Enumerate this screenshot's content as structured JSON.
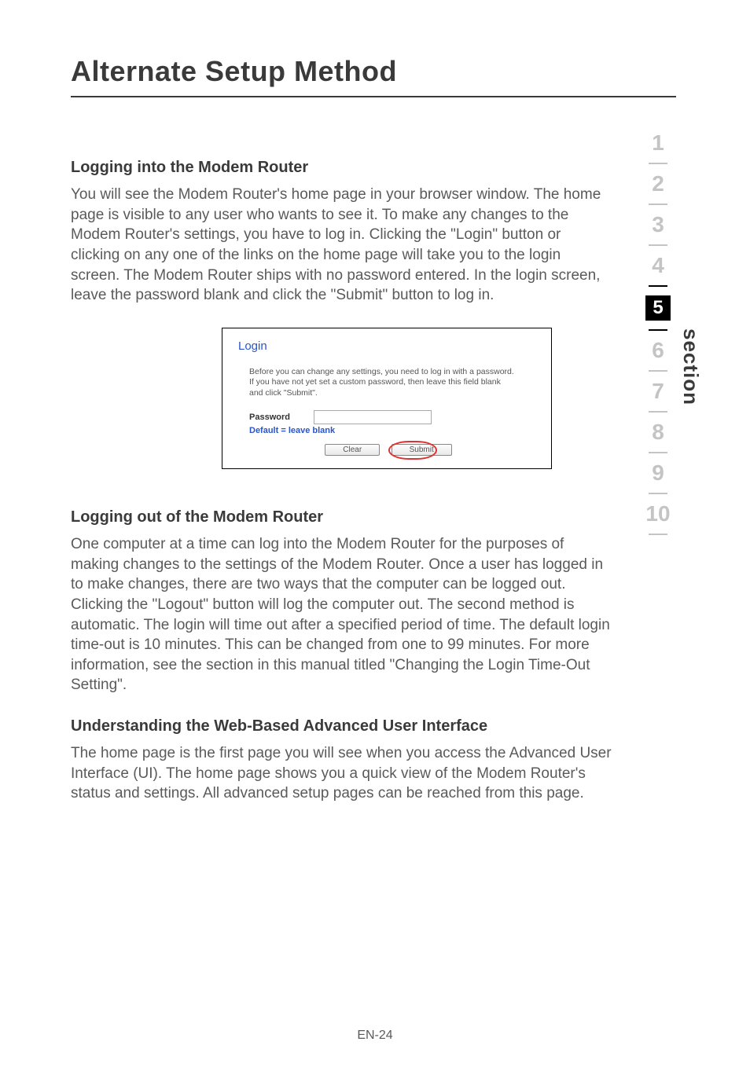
{
  "page_title": "Alternate Setup Method",
  "section_a": {
    "heading": "Logging into the Modem Router",
    "body": "You will see the Modem Router's home page in your browser window. The home page is visible to any user who wants to see it. To make any changes to the Modem Router's settings, you have to log in. Clicking the \"Login\" button or clicking on any one of the links on the home page will take you to the login screen. The Modem Router ships with no password entered. In the login screen, leave the password blank and click the \"Submit\" button to log in."
  },
  "login_box": {
    "title": "Login",
    "description": "Before you can change any settings, you need to log in with a password. If you have not yet set a custom password, then leave this field blank and click \"Submit\".",
    "password_label": "Password",
    "default_text": "Default = leave blank",
    "clear_button": "Clear",
    "submit_button": "Submit"
  },
  "section_b": {
    "heading": "Logging out of the Modem Router",
    "body": "One computer at a time can log into the Modem Router for the purposes of making changes to the settings of the Modem Router. Once a user has logged in to make changes, there are two ways that the computer can be logged out. Clicking the \"Logout\" button will log the computer out. The second method is automatic. The login will time out after a specified period of time. The default login time-out is 10 minutes. This can be changed from one to 99 minutes. For more information, see the section in this manual titled \"Changing the Login Time-Out Setting\"."
  },
  "section_c": {
    "heading": "Understanding the Web-Based Advanced User Interface",
    "body": "The home page is the first page you will see when you access the Advanced User Interface (UI). The home page shows you a quick view of the Modem Router's status and settings. All advanced setup pages can be reached from this page."
  },
  "side_nav": {
    "items": [
      "1",
      "2",
      "3",
      "4",
      "5",
      "6",
      "7",
      "8",
      "9",
      "10"
    ],
    "active_index": 4,
    "label": "section"
  },
  "footer": "EN-24"
}
